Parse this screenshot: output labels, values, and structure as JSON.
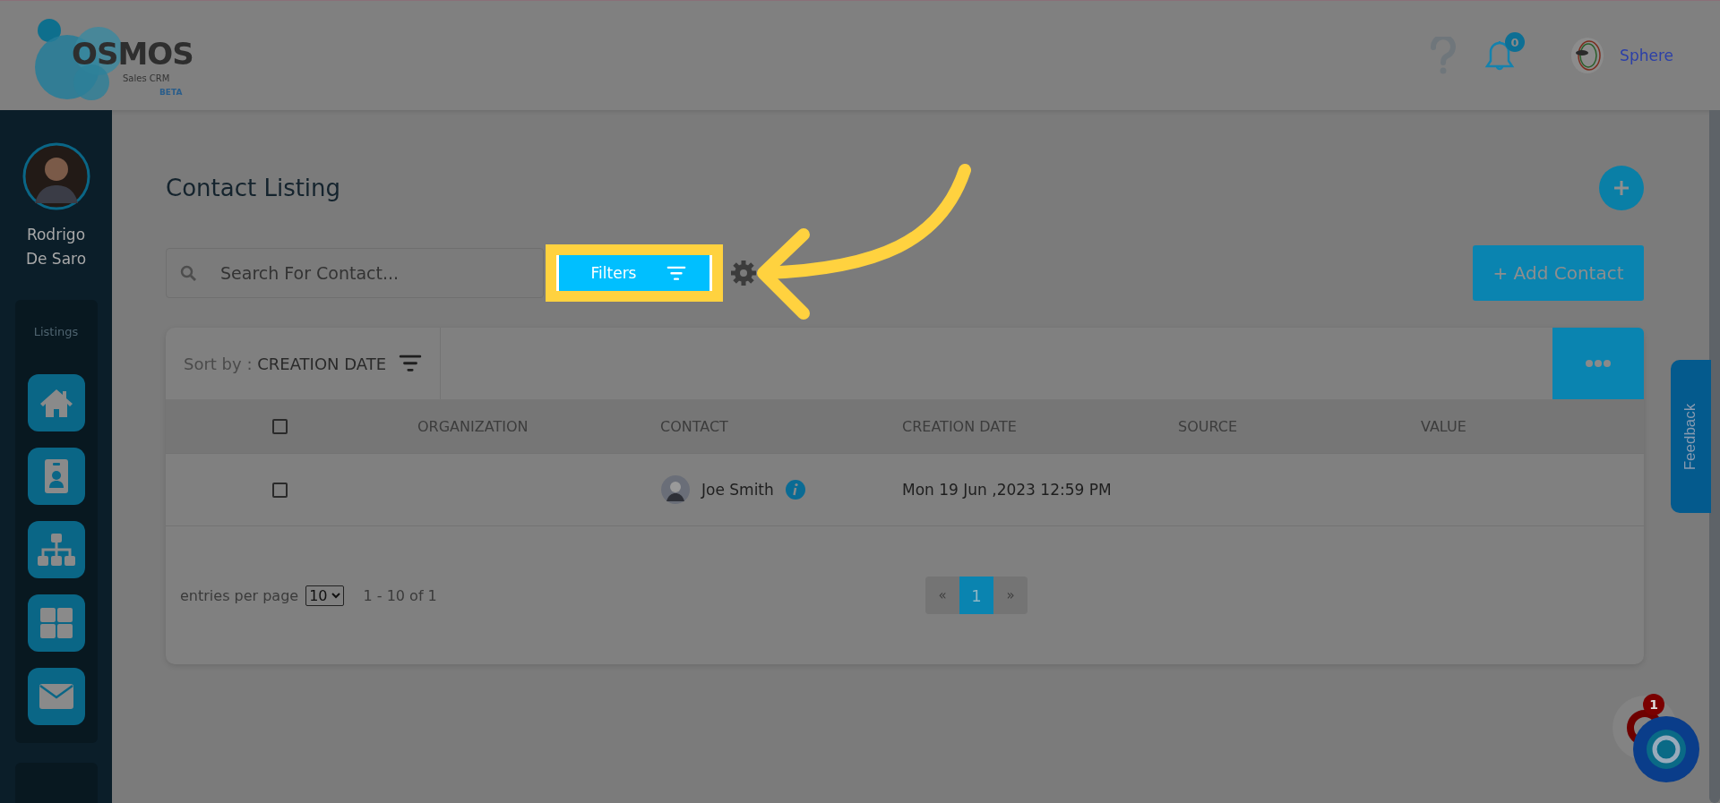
{
  "logo": {
    "name": "OSMOS",
    "tagline": "Sales CRM",
    "badge": "BETA"
  },
  "header": {
    "notifications_count": "0",
    "account_name": "Sphere"
  },
  "user": {
    "name": "Rodrigo De Saro"
  },
  "sidebar": {
    "section": "Listings"
  },
  "page": {
    "title": "Contact Listing",
    "search": {
      "placeholder": "Search For Contact..."
    },
    "filters_button": "Filters",
    "add_button": "+ Add Contact"
  },
  "sort": {
    "label": "Sort by :",
    "value": "CREATION DATE"
  },
  "table": {
    "select_all_checked": false,
    "columns": [
      "ORGANIZATION",
      "CONTACT",
      "CREATION DATE",
      "SOURCE",
      "VALUE"
    ],
    "rows": [
      {
        "checked": false,
        "contact": "Joe Smith",
        "creation_date": "Mon 19 Jun ,2023 12:59 PM"
      }
    ]
  },
  "footer": {
    "entries_label": "entries per page",
    "page_size": "10",
    "range": "1 - 10 of 1",
    "prev": "«",
    "next": "»",
    "pages": [
      {
        "label": "1",
        "selected": true
      }
    ]
  },
  "feedback": "Feedback",
  "chat": {
    "badge": "1"
  }
}
